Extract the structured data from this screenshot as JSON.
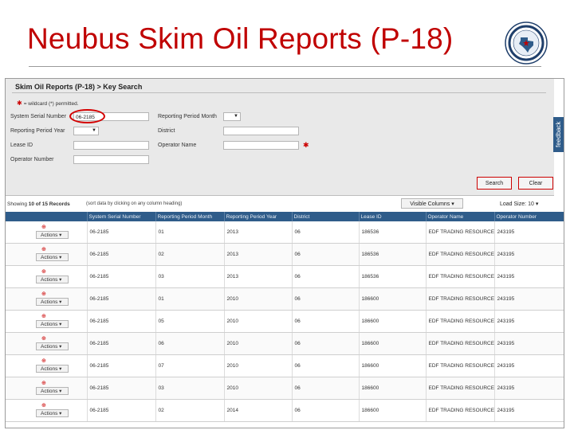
{
  "slide": {
    "title": "Neubus Skim Oil Reports (P-18)"
  },
  "app": {
    "breadcrumb": "Skim Oil Reports (P-18) > Key Search",
    "feedback_label": "feedback",
    "required_note": "= wildcard (*) permitted.",
    "form": {
      "system_serial_label": "System Serial Number",
      "system_serial_value": "06-2185",
      "reporting_period_month_label": "Reporting Period Month",
      "reporting_period_year_label": "Reporting Period Year",
      "district_label": "District",
      "lease_id_label": "Lease ID",
      "operator_name_label": "Operator Name",
      "operator_number_label": "Operator Number"
    },
    "buttons": {
      "search": "Search",
      "clear": "Clear"
    },
    "results": {
      "showing_prefix": "Showing",
      "showing_count": "10 of 15 Records",
      "sort_note": "(sort data by clicking on any column heading)",
      "visible_columns": "Visible Columns",
      "load_size_label": "Load Size:",
      "load_size_value": "10"
    },
    "grid": {
      "action_label": "Actions",
      "columns": [
        "",
        "System Serial Number",
        "Reporting Period Month",
        "Reporting Period Year",
        "District",
        "Lease ID",
        "Operator Name",
        "Operator Number"
      ],
      "rows": [
        [
          "06-2185",
          "01",
          "2013",
          "06",
          "186536",
          "EDF TRADING RESOURCES, LLC",
          "243195"
        ],
        [
          "06-2185",
          "02",
          "2013",
          "06",
          "186536",
          "EDF TRADING RESOURCES, LLC",
          "243195"
        ],
        [
          "06-2185",
          "03",
          "2013",
          "06",
          "186536",
          "EDF TRADING RESOURCES, LLC",
          "243195"
        ],
        [
          "06-2185",
          "01",
          "2010",
          "06",
          "186600",
          "EDF TRADING RESOURCES, LLC",
          "243195"
        ],
        [
          "06-2185",
          "05",
          "2010",
          "06",
          "186600",
          "EDF TRADING RESOURCES, LLC",
          "243195"
        ],
        [
          "06-2185",
          "06",
          "2010",
          "06",
          "186600",
          "EDF TRADING RESOURCES, LLC",
          "243195"
        ],
        [
          "06-2185",
          "07",
          "2010",
          "06",
          "186600",
          "EDF TRADING RESOURCES, LLC",
          "243195"
        ],
        [
          "06-2185",
          "03",
          "2010",
          "06",
          "186600",
          "EDF TRADING RESOURCES, LLC",
          "243195"
        ],
        [
          "06-2185",
          "02",
          "2014",
          "06",
          "186600",
          "EDF TRADING RESOURCES, LLC",
          "243195"
        ]
      ]
    }
  },
  "colors": {
    "title": "#c00000",
    "header_bar": "#2f5c8a",
    "highlight": "#d40000"
  }
}
